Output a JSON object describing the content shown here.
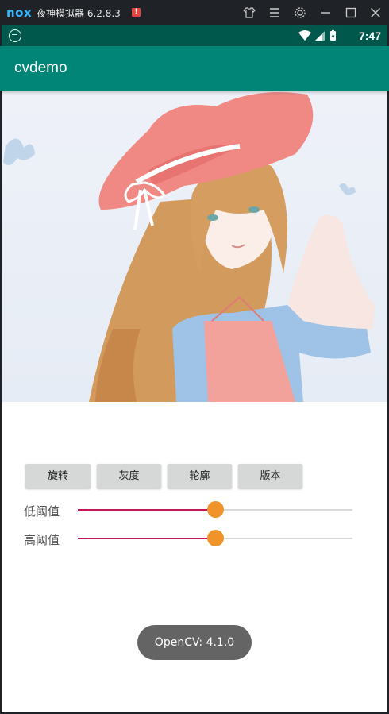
{
  "emulator": {
    "logo_text": "nox",
    "title": "夜神模拟器 6.2.8.3",
    "alert_badge": "!"
  },
  "status_bar": {
    "time": "7:47"
  },
  "app_bar": {
    "title": "cvdemo"
  },
  "buttons": [
    {
      "label": "旋转"
    },
    {
      "label": "灰度"
    },
    {
      "label": "轮廓"
    },
    {
      "label": "版本"
    }
  ],
  "sliders": [
    {
      "label": "低阈值",
      "value_fraction": 0.5
    },
    {
      "label": "高阈值",
      "value_fraction": 0.5
    }
  ],
  "toast": {
    "text": "OpenCV: 4.1.0"
  },
  "colors": {
    "app_bar": "#008577",
    "status_bar": "#00574b",
    "slider_fill": "#c2185b",
    "slider_thumb": "#f0932b"
  }
}
